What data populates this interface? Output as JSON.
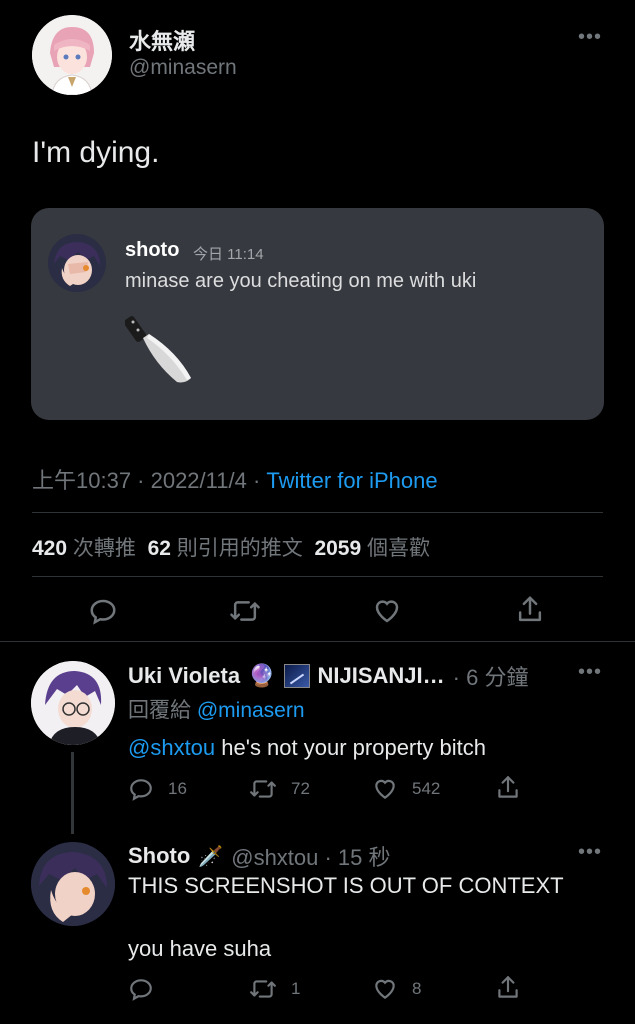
{
  "main_tweet": {
    "display_name": "水無瀬",
    "handle": "@minasern",
    "more_icon": "more-horizontal-icon",
    "text": "I'm dying.",
    "embed": {
      "username": "shoto",
      "timestamp": "今日 11:14",
      "message": "minase are you cheating on me with uki",
      "emoji": "🔪"
    },
    "time": "上午10:37 · 2022/11/4 · ",
    "source": "Twitter for iPhone",
    "stats": {
      "retweets_count": "420",
      "retweets_label": "次轉推",
      "quotes_count": "62",
      "quotes_label": "則引用的推文",
      "likes_count": "2059",
      "likes_label": "個喜歡"
    }
  },
  "replies": [
    {
      "display_name": "Uki Violeta",
      "badges": "🔮",
      "org_name": "NIJISANJI…",
      "time": "· 6 分鐘",
      "reply_to_label": "回覆給 ",
      "reply_to_handle": "@minasern",
      "mention": "@shxtou",
      "text": " he's not your property bitch",
      "reply_count": "16",
      "retweet_count": "72",
      "like_count": "542"
    },
    {
      "display_name": "Shoto",
      "badge": "🗡️",
      "handle_time": "@shxtou · 15 秒",
      "text_line1": "THIS SCREENSHOT IS OUT OF CONTEXT",
      "text_line2": "you have suha",
      "reply_count": "",
      "retweet_count": "1",
      "like_count": "8"
    }
  ],
  "colors": {
    "background": "#000000",
    "accent": "#1d9bf0",
    "muted": "#71767b",
    "embed_bg": "#36393f"
  }
}
